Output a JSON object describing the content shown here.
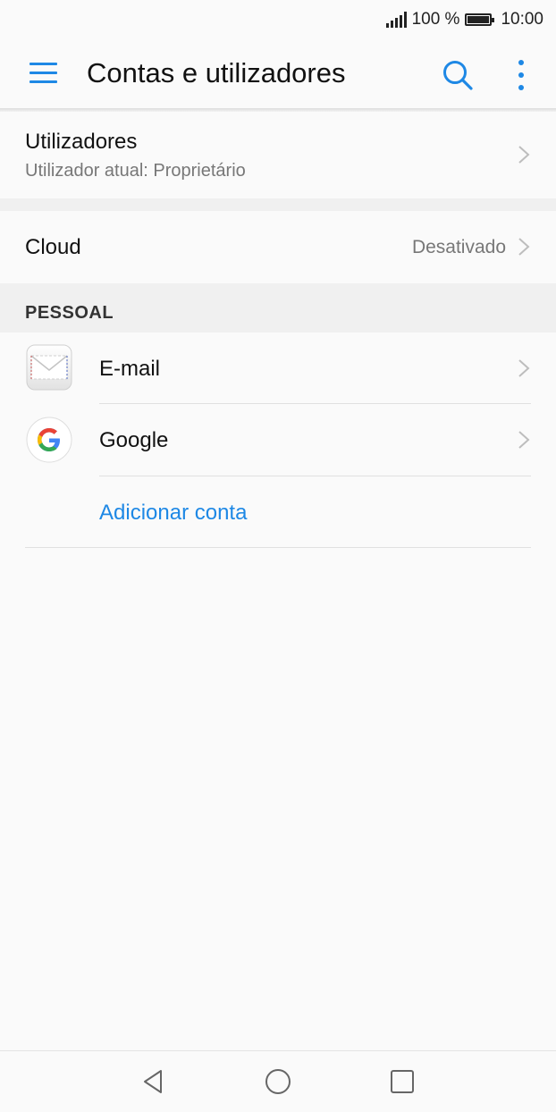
{
  "status_bar": {
    "battery_text": "100 %",
    "time": "10:00"
  },
  "app_bar": {
    "title": "Contas e utilizadores",
    "menu_icon": "hamburger-menu-icon",
    "search_icon": "search-icon",
    "more_icon": "more-vert-icon"
  },
  "users_row": {
    "title": "Utilizadores",
    "subtitle": "Utilizador atual: Proprietário"
  },
  "cloud_row": {
    "title": "Cloud",
    "value": "Desativado"
  },
  "personal_section": {
    "header": "PESSOAL",
    "accounts": [
      {
        "label": "E-mail",
        "icon": "email-envelope-icon"
      },
      {
        "label": "Google",
        "icon": "google-icon"
      }
    ],
    "add_account_label": "Adicionar conta"
  },
  "nav_bar": {
    "back_icon": "back-triangle-icon",
    "home_icon": "home-circle-icon",
    "recents_icon": "recents-square-icon"
  },
  "colors": {
    "accent": "#1e88e5",
    "background": "#fafafa",
    "section_gap": "#f0f0f0"
  }
}
